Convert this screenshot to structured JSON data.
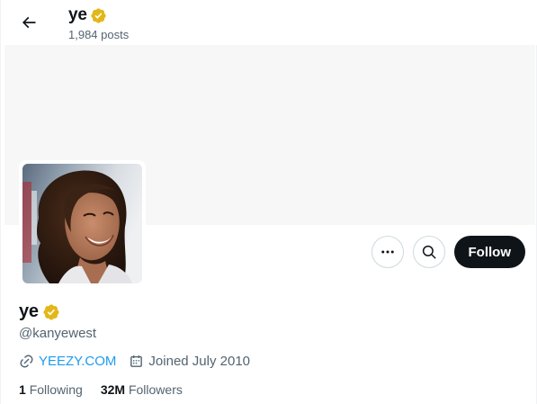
{
  "header": {
    "name": "ye",
    "posts_count": "1,984 posts"
  },
  "profile": {
    "name": "ye",
    "handle": "@kanyewest",
    "website": "YEEZY.COM",
    "joined": "Joined July 2010",
    "following_count": "1",
    "following_label": "Following",
    "followers_count": "32M",
    "followers_label": "Followers"
  },
  "actions": {
    "more_icon": "more-horizontal-icon",
    "search_icon": "search-icon",
    "follow_label": "Follow"
  },
  "icons": {
    "back": "arrow-left-icon",
    "verified": "verified-badge-icon",
    "link": "link-icon",
    "calendar": "calendar-icon"
  },
  "colors": {
    "verified_gold": "#e2b719",
    "link_blue": "#1d9bf0",
    "follow_bg": "#0f1419",
    "secondary_text": "#536471",
    "banner_bg": "#f7f7f7"
  }
}
